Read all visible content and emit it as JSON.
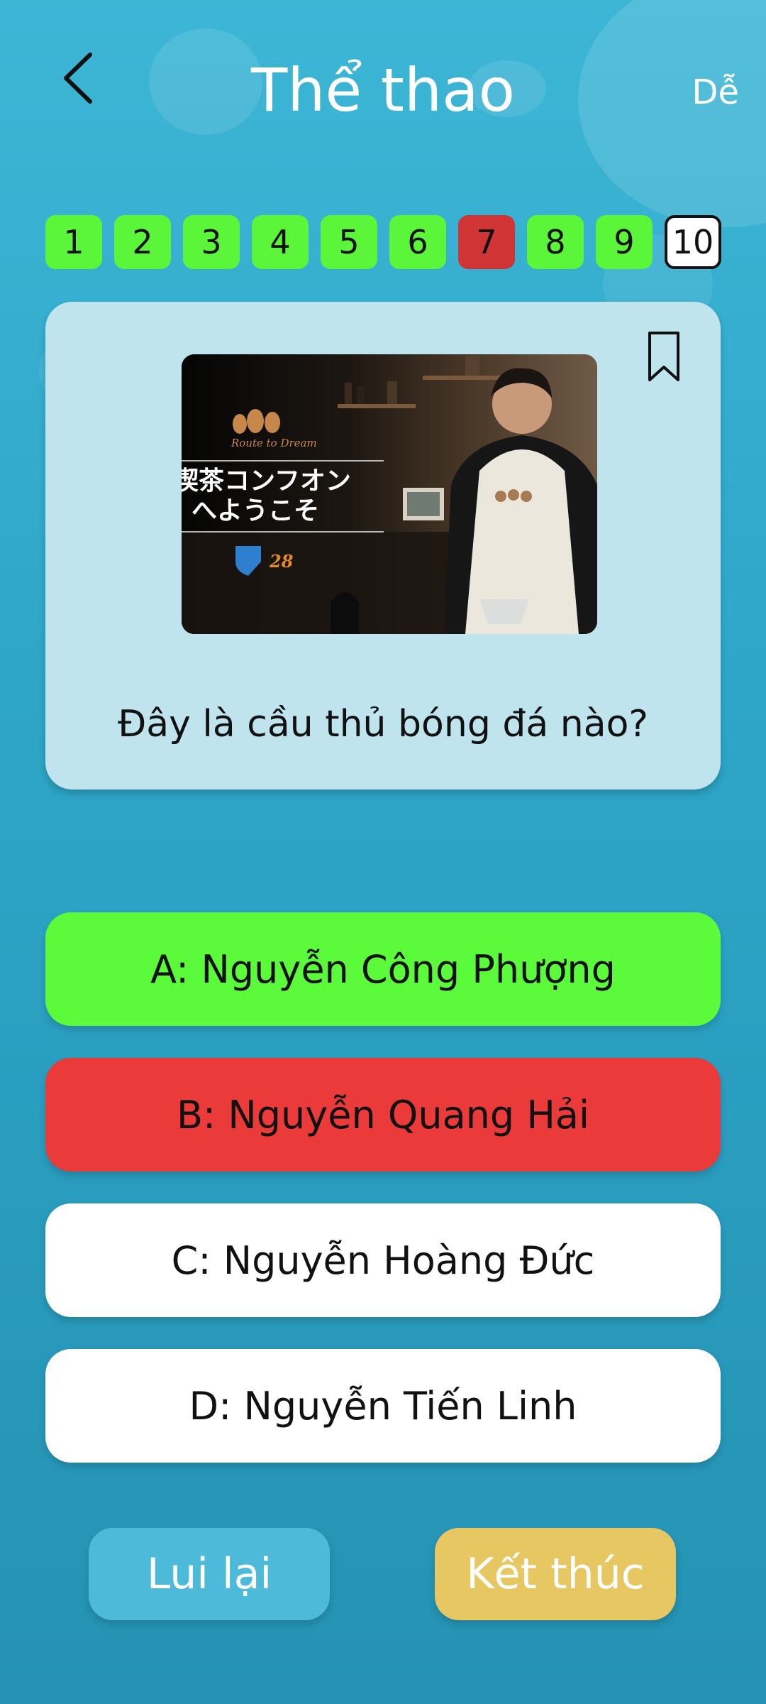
{
  "header": {
    "title": "Thể thao",
    "difficulty": "Dễ"
  },
  "question_nav": [
    {
      "label": "1",
      "state": "done"
    },
    {
      "label": "2",
      "state": "done"
    },
    {
      "label": "3",
      "state": "done"
    },
    {
      "label": "4",
      "state": "done"
    },
    {
      "label": "5",
      "state": "done"
    },
    {
      "label": "6",
      "state": "done"
    },
    {
      "label": "7",
      "state": "wrong"
    },
    {
      "label": "8",
      "state": "done"
    },
    {
      "label": "9",
      "state": "done"
    },
    {
      "label": "10",
      "state": "current"
    }
  ],
  "question": {
    "image_text": {
      "brand": "Route to Dream",
      "line1": "喫茶コンフオン",
      "line2": "へようこそ",
      "number": "28"
    },
    "text": "Đây là cầu thủ bóng đá nào?"
  },
  "answers": [
    {
      "label": "A: Nguyễn Công Phượng",
      "state": "correct"
    },
    {
      "label": "B: Nguyễn Quang Hải",
      "state": "incorrect"
    },
    {
      "label": "C: Nguyễn Hoàng Đức",
      "state": "neutral"
    },
    {
      "label": "D: Nguyễn Tiến Linh",
      "state": "neutral"
    }
  ],
  "footer": {
    "back_label": "Lui lại",
    "finish_label": "Kết thúc"
  },
  "colors": {
    "background": "#2ea6c8",
    "done": "#5bf53a",
    "wrong": "#d03434",
    "card": "#bfe4ee",
    "back_button": "#4cbad8",
    "finish_button": "#e7c762"
  },
  "icons": {
    "back": "chevron-left-icon",
    "bookmark": "bookmark-icon"
  }
}
